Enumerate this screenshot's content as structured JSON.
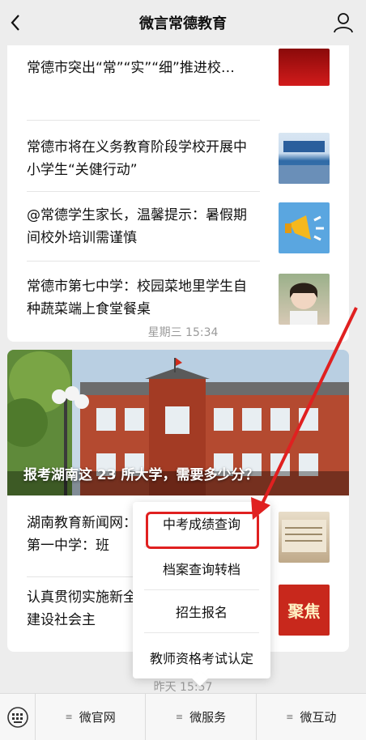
{
  "header": {
    "title": "微言常德教育"
  },
  "feed": {
    "card1_items": [
      "常德市突出“常”“实”“细”推进校…",
      "常德市将在义务教育阶段学校开展中小学生“关健行动”",
      "@常德学生家长，温馨提示：暑假期间校外培训需谨慎",
      "常德市第七中学：校园菜地里学生自种蔬菜端上食堂餐桌"
    ],
    "timestamp1": "星期三 15:34",
    "hero_title": "报考湖南这 23 所大学，需要多少分？",
    "card2_items": [
      "湖南教育新闻网：县第一中学：班",
      "认真贯彻实施新全面建设社会主"
    ],
    "thumb_badge": "聚焦",
    "timestamp2": "昨天 15:57"
  },
  "popup_menu": {
    "items": [
      "中考成绩查询",
      "档案查询转档",
      "招生报名",
      "教师资格考试认定"
    ]
  },
  "footer": {
    "tabs": [
      "微官网",
      "微服务",
      "微互动"
    ]
  },
  "colors": {
    "highlight": "#e02020",
    "bg": "#ededed"
  }
}
